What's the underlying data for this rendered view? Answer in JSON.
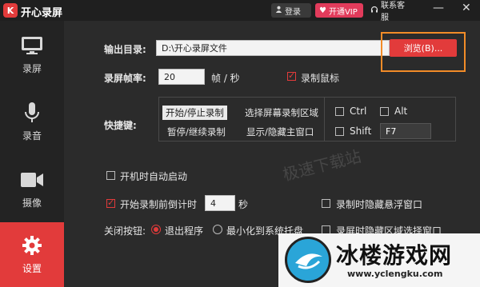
{
  "titlebar": {
    "logo_glyph": "K",
    "title": "开心录屏",
    "login_label": "登录",
    "vip_label": "开通VIP",
    "support_label": "联系客服",
    "minimize_glyph": "—",
    "close_glyph": "✕"
  },
  "sidebar": {
    "items": [
      {
        "label": "录屏"
      },
      {
        "label": "录音"
      },
      {
        "label": "摄像"
      },
      {
        "label": "设置"
      }
    ]
  },
  "settings": {
    "output_dir_label": "输出目录:",
    "output_dir_value": "D:\\开心录屏文件",
    "browse_label": "浏览(B)...",
    "fps_label": "录屏帧率:",
    "fps_value": "20",
    "fps_unit": "帧 / 秒",
    "record_mouse_label": "录制鼠标",
    "record_mouse_checked": true,
    "hotkey_label": "快捷键:",
    "hotkey_actions": [
      "开始/停止录制",
      "选择屏幕录制区域",
      "暂停/继续录制",
      "显示/隐藏主窗口"
    ],
    "ctrl_label": "Ctrl",
    "alt_label": "Alt",
    "shift_label": "Shift",
    "key_value": "F7",
    "autostart_label": "开机时自动启动",
    "countdown_label": "开始录制前倒计时",
    "countdown_value": "4",
    "countdown_unit": "秒",
    "hide_float_label": "录制时隐藏悬浮窗口",
    "close_btn_label": "关闭按钮:",
    "exit_label": "退出程序",
    "minimize_tray_label": "最小化到系统托盘",
    "hide_region_label": "录屏时隐藏区域选择窗口"
  },
  "watermark_text": "极速下载站",
  "brand": {
    "name": "冰楼游戏网",
    "url": "www.yclengku.com"
  },
  "colors": {
    "accent": "#e23b3b",
    "highlight": "#f28c28"
  }
}
